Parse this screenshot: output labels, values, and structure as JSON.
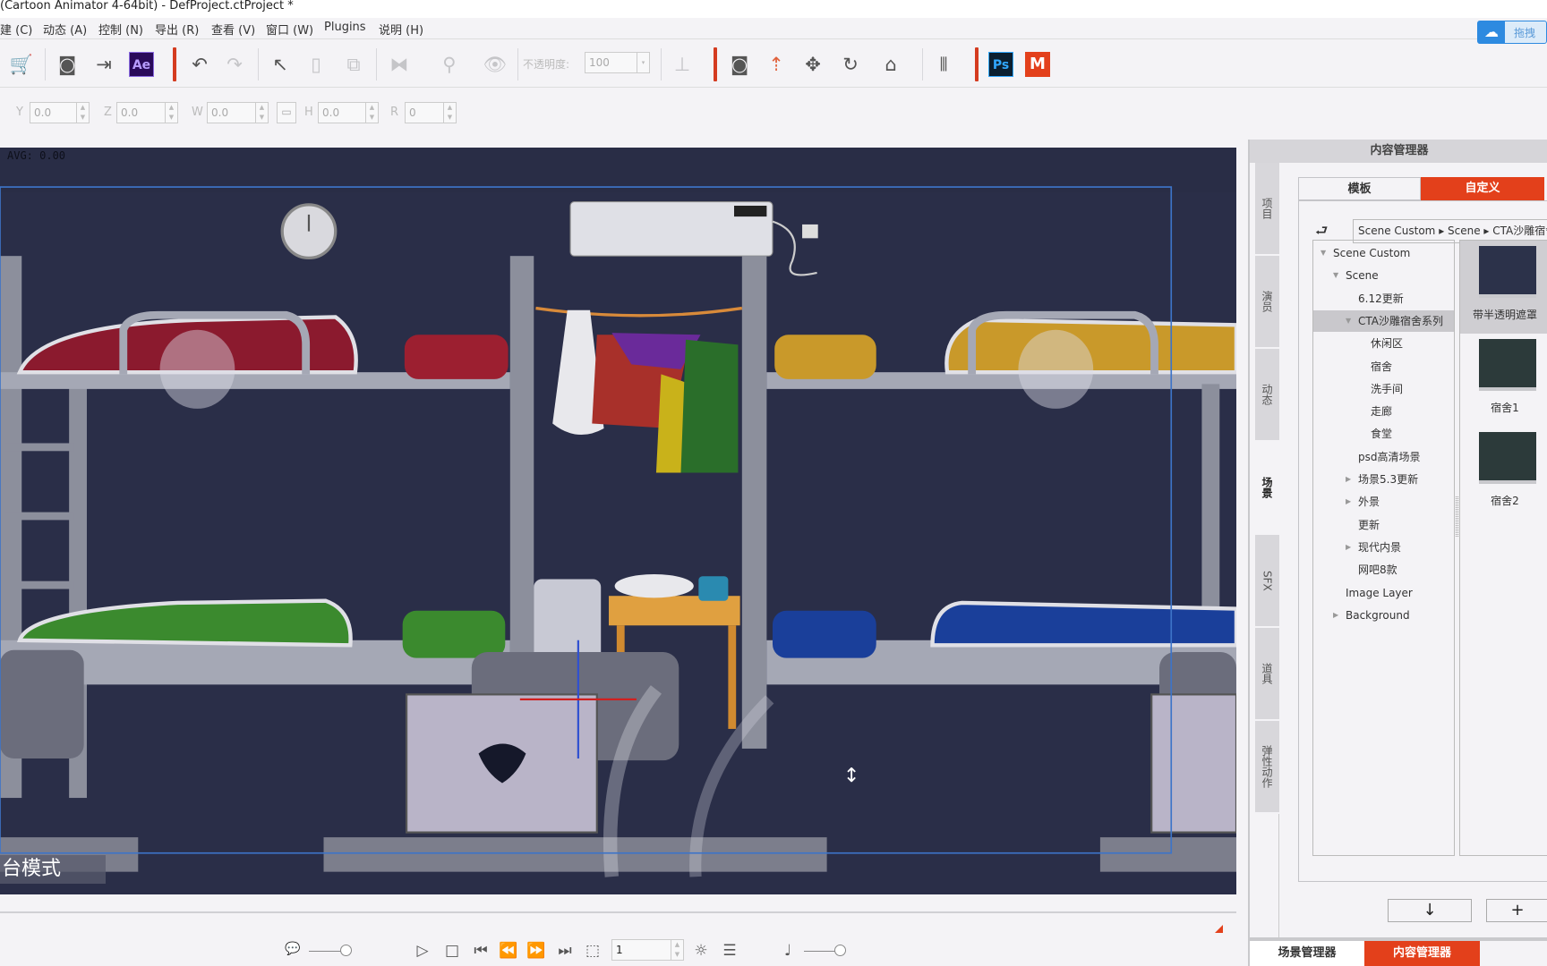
{
  "window": {
    "title": "(Cartoon Animator 4-64bit) - DefProject.ctProject *"
  },
  "menu": [
    "建 (C)",
    "动态 (A)",
    "控制 (N)",
    "导出 (R)",
    "查看 (V)",
    "窗口 (W)",
    "Plugins",
    "说明 (H)"
  ],
  "cloud_button": {
    "icon": "baidu-cloud-icon",
    "label": "拖拽"
  },
  "toolbar": {
    "opacity_label": "不透明度:",
    "opacity_value": "100",
    "ae_label": "Ae",
    "ps_label": "Ps",
    "m_label": "M"
  },
  "transform": {
    "y_label": "Y",
    "y": "0.0",
    "z_label": "Z",
    "z": "0.0",
    "w_label": "W",
    "w": "0.0",
    "h_label": "H",
    "h": "0.0",
    "r_label": "R",
    "r": "0"
  },
  "canvas": {
    "avg": "AVG: 0.00",
    "mode": "台模式"
  },
  "panel": {
    "title": "内容管理器",
    "side_tabs": [
      {
        "label": "项目"
      },
      {
        "label": "演员"
      },
      {
        "label": "动态"
      },
      {
        "label": "场景",
        "active": true
      },
      {
        "label": "SFX"
      },
      {
        "label": "道具"
      },
      {
        "label": "弹性动作"
      }
    ],
    "tabs": [
      {
        "label": "模板"
      },
      {
        "label": "自定义",
        "active": true
      }
    ],
    "breadcrumb": "Scene Custom ▸ Scene ▸ CTA沙雕宿舍系列",
    "tree": [
      {
        "label": "Scene Custom",
        "expander": "▼"
      },
      {
        "label": "Scene",
        "expander": "▼"
      },
      {
        "label": "6.12更新",
        "expander": ""
      },
      {
        "label": "CTA沙雕宿舍系列",
        "expander": "▼",
        "selected": true
      },
      {
        "label": "休闲区",
        "expander": ""
      },
      {
        "label": "宿舍",
        "expander": ""
      },
      {
        "label": "洗手间",
        "expander": ""
      },
      {
        "label": "走廊",
        "expander": ""
      },
      {
        "label": "食堂",
        "expander": ""
      },
      {
        "label": "psd高清场景",
        "expander": ""
      },
      {
        "label": "场景5.3更新",
        "expander": "▶"
      },
      {
        "label": "外景",
        "expander": "▶"
      },
      {
        "label": "更新",
        "expander": ""
      },
      {
        "label": "现代内景",
        "expander": "▶"
      },
      {
        "label": "网吧8款",
        "expander": ""
      },
      {
        "label": "Image Layer",
        "expander": ""
      },
      {
        "label": "Background",
        "expander": "▶"
      }
    ],
    "thumbnails": [
      {
        "label": "带半透明遮罩",
        "selected": true
      },
      {
        "label": "宿舍1"
      },
      {
        "label": "宿舍2"
      }
    ],
    "buttons": {
      "download": "↓",
      "add": "+"
    },
    "bottom_tabs": [
      {
        "label": "场景管理器"
      },
      {
        "label": "内容管理器",
        "active": true
      }
    ]
  },
  "timeline": {
    "frame": "1"
  },
  "colors": {
    "accent": "#e3401b",
    "canvas_bg": "#2a2e48",
    "selection": "#3d74c8"
  }
}
